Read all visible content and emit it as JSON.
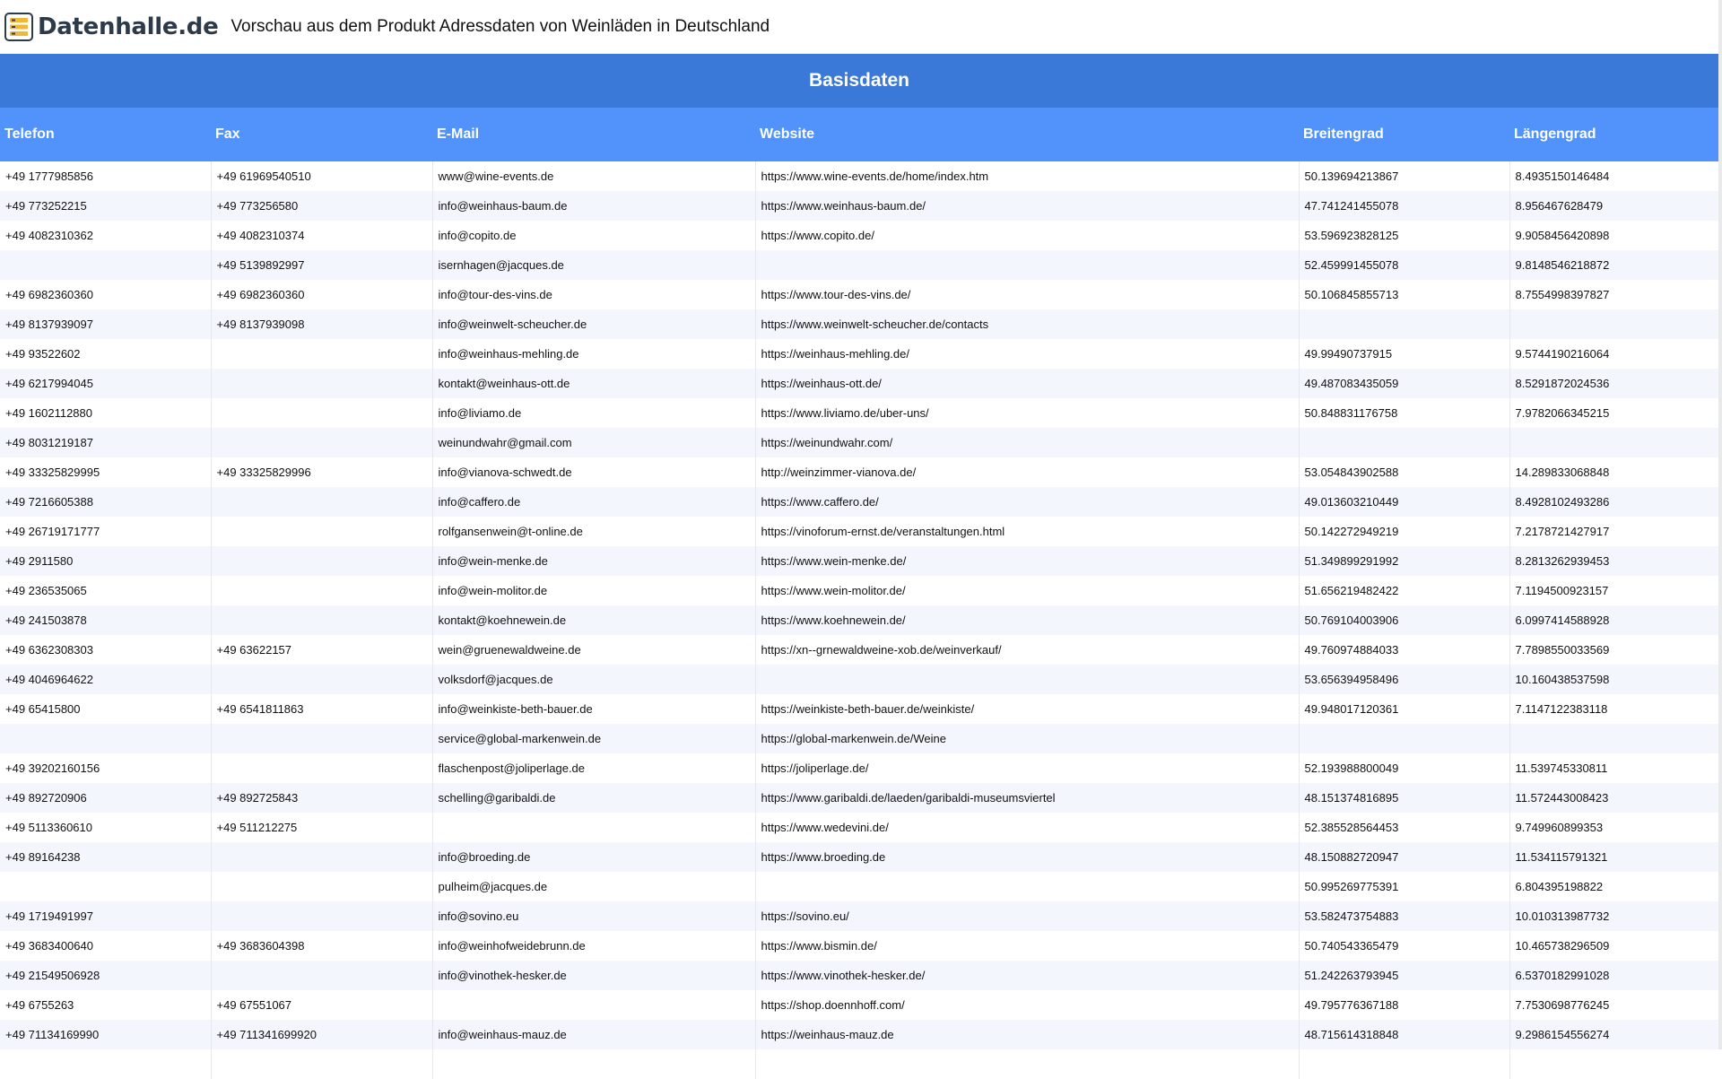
{
  "header": {
    "logo_text": "Datenhalle.de",
    "title": "Vorschau aus dem Produkt Adressdaten von Weinläden in Deutschland"
  },
  "section": {
    "title": "Basisdaten"
  },
  "columns": [
    "Telefon",
    "Fax",
    "E-Mail",
    "Website",
    "Breitengrad",
    "Längengrad"
  ],
  "rows": [
    [
      "+49 1777985856",
      "+49 61969540510",
      "www@wine-events.de",
      "https://www.wine-events.de/home/index.htm",
      "50.139694213867",
      "8.4935150146484"
    ],
    [
      "+49 773252215",
      "+49 773256580",
      "info@weinhaus-baum.de",
      "https://www.weinhaus-baum.de/",
      "47.741241455078",
      "8.956467628479"
    ],
    [
      "+49 4082310362",
      "+49 4082310374",
      "info@copito.de",
      "https://www.copito.de/",
      "53.596923828125",
      "9.9058456420898"
    ],
    [
      "",
      "+49 5139892997",
      "isernhagen@jacques.de",
      "",
      "52.459991455078",
      "9.8148546218872"
    ],
    [
      "+49 6982360360",
      "+49 6982360360",
      "info@tour-des-vins.de",
      "https://www.tour-des-vins.de/",
      "50.106845855713",
      "8.7554998397827"
    ],
    [
      "+49 8137939097",
      "+49 8137939098",
      "info@weinwelt-scheucher.de",
      "https://www.weinwelt-scheucher.de/contacts",
      "",
      ""
    ],
    [
      "+49 93522602",
      "",
      "info@weinhaus-mehling.de",
      "https://weinhaus-mehling.de/",
      "49.99490737915",
      "9.5744190216064"
    ],
    [
      "+49 6217994045",
      "",
      "kontakt@weinhaus-ott.de",
      "https://weinhaus-ott.de/",
      "49.487083435059",
      "8.5291872024536"
    ],
    [
      "+49 1602112880",
      "",
      "info@liviamo.de",
      "https://www.liviamo.de/uber-uns/",
      "50.848831176758",
      "7.9782066345215"
    ],
    [
      "+49 8031219187",
      "",
      "weinundwahr@gmail.com",
      "https://weinundwahr.com/",
      "",
      ""
    ],
    [
      "+49 33325829995",
      "+49 33325829996",
      "info@vianova-schwedt.de",
      "http://weinzimmer-vianova.de/",
      "53.054843902588",
      "14.289833068848"
    ],
    [
      "+49 7216605388",
      "",
      "info@caffero.de",
      "https://www.caffero.de/",
      "49.013603210449",
      "8.4928102493286"
    ],
    [
      "+49 26719171777",
      "",
      "rolfgansenwein@t-online.de",
      "https://vinoforum-ernst.de/veranstaltungen.html",
      "50.142272949219",
      "7.2178721427917"
    ],
    [
      "+49 2911580",
      "",
      "info@wein-menke.de",
      "https://www.wein-menke.de/",
      "51.349899291992",
      "8.2813262939453"
    ],
    [
      "+49 236535065",
      "",
      "info@wein-molitor.de",
      "https://www.wein-molitor.de/",
      "51.656219482422",
      "7.1194500923157"
    ],
    [
      "+49 241503878",
      "",
      "kontakt@koehnewein.de",
      "https://www.koehnewein.de/",
      "50.769104003906",
      "6.0997414588928"
    ],
    [
      "+49 6362308303",
      "+49 63622157",
      "wein@gruenewaldweine.de",
      "https://xn--grnewaldweine-xob.de/weinverkauf/",
      "49.760974884033",
      "7.7898550033569"
    ],
    [
      "+49 4046964622",
      "",
      "volksdorf@jacques.de",
      "",
      "53.656394958496",
      "10.160438537598"
    ],
    [
      "+49 65415800",
      "+49 6541811863",
      "info@weinkiste-beth-bauer.de",
      "https://weinkiste-beth-bauer.de/weinkiste/",
      "49.948017120361",
      "7.1147122383118"
    ],
    [
      "",
      "",
      "service@global-markenwein.de",
      "https://global-markenwein.de/Weine",
      "",
      ""
    ],
    [
      "+49 39202160156",
      "",
      "flaschenpost@joliperlage.de",
      "https://joliperlage.de/",
      "52.193988800049",
      "11.539745330811"
    ],
    [
      "+49 892720906",
      "+49 892725843",
      "schelling@garibaldi.de",
      "https://www.garibaldi.de/laeden/garibaldi-museumsviertel",
      "48.151374816895",
      "11.572443008423"
    ],
    [
      "+49 5113360610",
      "+49 511212275",
      "",
      "https://www.wedevini.de/",
      "52.385528564453",
      "9.749960899353"
    ],
    [
      "+49 89164238",
      "",
      "info@broeding.de",
      "https://www.broeding.de",
      "48.150882720947",
      "11.534115791321"
    ],
    [
      "",
      "",
      "pulheim@jacques.de",
      "",
      "50.995269775391",
      "6.804395198822"
    ],
    [
      "+49 1719491997",
      "",
      "info@sovino.eu",
      "https://sovino.eu/",
      "53.582473754883",
      "10.010313987732"
    ],
    [
      "+49 3683400640",
      "+49 3683604398",
      "info@weinhofweidebrunn.de",
      "https://www.bismin.de/",
      "50.740543365479",
      "10.465738296509"
    ],
    [
      "+49 21549506928",
      "",
      "info@vinothek-hesker.de",
      "https://www.vinothek-hesker.de/",
      "51.242263793945",
      "6.5370182991028"
    ],
    [
      "+49 6755263",
      "+49 67551067",
      "",
      "https://shop.doennhoff.com/",
      "49.795776367188",
      "7.7530698776245"
    ],
    [
      "+49 71134169990",
      "+49 711341699920",
      "info@weinhaus-mauz.de",
      "https://weinhaus-mauz.de",
      "48.715614318848",
      "9.2986154556274"
    ],
    [
      "",
      "",
      "",
      "",
      "",
      ""
    ]
  ]
}
